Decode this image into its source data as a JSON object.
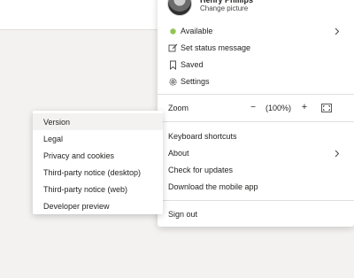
{
  "profile": {
    "name": "Henry Phillips",
    "change_picture": "Change picture",
    "status": "Available",
    "set_status": "Set status message",
    "saved": "Saved",
    "settings": "Settings",
    "status_color": "#92c353"
  },
  "zoom": {
    "label": "Zoom",
    "minus": "−",
    "level": "(100%)",
    "plus": "+"
  },
  "menu": {
    "keyboard_shortcuts": "Keyboard shortcuts",
    "about": "About",
    "check_updates": "Check for updates",
    "download_app": "Download the mobile app",
    "sign_out": "Sign out"
  },
  "about_submenu": {
    "items": [
      {
        "label": "Version"
      },
      {
        "label": "Legal"
      },
      {
        "label": "Privacy and cookies"
      },
      {
        "label": "Third-party notice (desktop)"
      },
      {
        "label": "Third-party notice (web)"
      },
      {
        "label": "Developer preview"
      }
    ],
    "active_index": 0
  }
}
